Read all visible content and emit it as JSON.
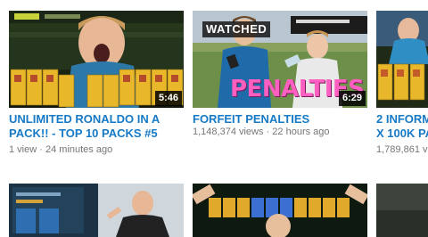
{
  "videos": [
    {
      "title": "UNLIMITED RONALDO IN A PACK!! - TOP 10 PACKS #5",
      "duration": "5:46",
      "views": "1 view",
      "separator": "·",
      "age": "24 minutes ago"
    },
    {
      "title": "FORFEIT PENALTIES",
      "duration": "6:29",
      "views": "1,148,374 views",
      "separator": "·",
      "age": "22 hours ago",
      "badge": "WATCHED",
      "overlay_text": "PENALTIES"
    },
    {
      "title": "2 INFORM",
      "title_line2": "x 100K PA",
      "views": "1,789,861 v"
    }
  ],
  "colors": {
    "title_link": "#167ac6",
    "meta_text": "#767676",
    "overlay_pink": "#ff5fc0"
  }
}
